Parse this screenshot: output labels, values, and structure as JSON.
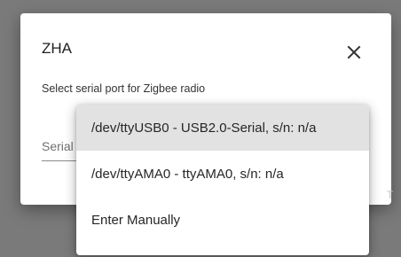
{
  "dialog": {
    "title": "ZHA",
    "description": "Select serial port for Zigbee radio",
    "close_icon": "close-icon",
    "select": {
      "label": "Serial"
    },
    "action_fragment": "T"
  },
  "menu": {
    "options": [
      {
        "label": "/dev/ttyUSB0 - USB2.0-Serial, s/n: n/a",
        "selected": true
      },
      {
        "label": "/dev/ttyAMA0 - ttyAMA0, s/n: n/a",
        "selected": false
      },
      {
        "label": "Enter Manually",
        "selected": false
      }
    ]
  },
  "colors": {
    "scrim": "#7a7a7a",
    "surface": "#ffffff",
    "selected_item": "#e2e2e2"
  }
}
